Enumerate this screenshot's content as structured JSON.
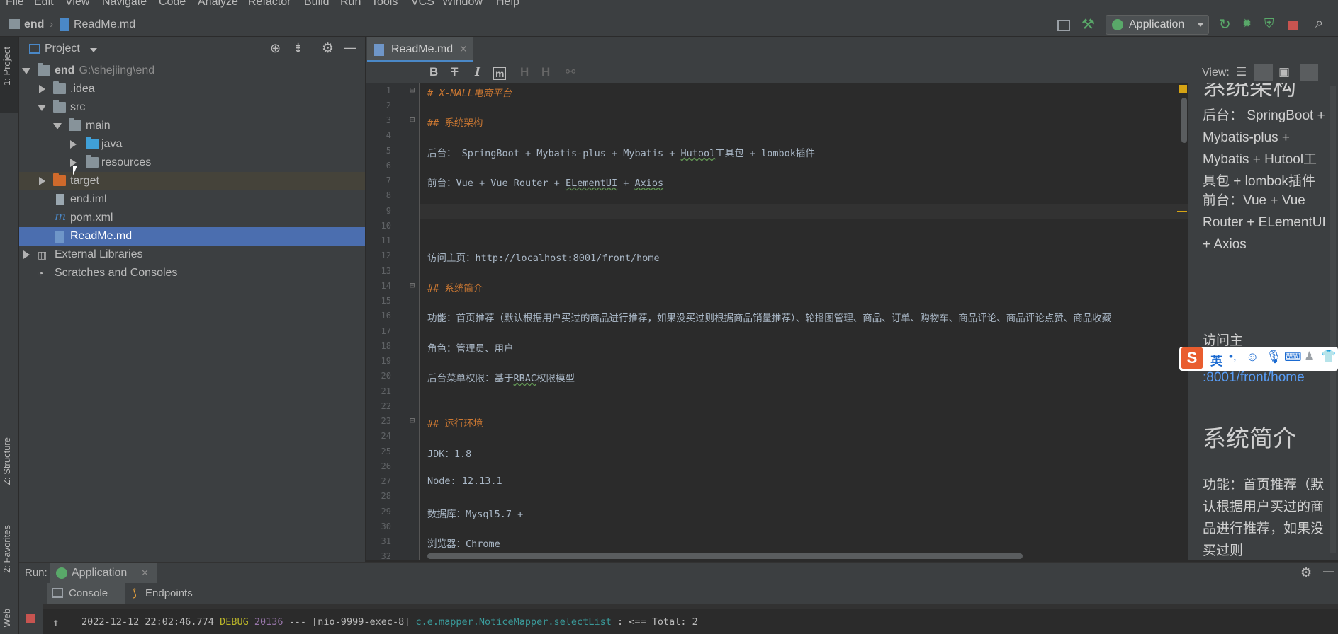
{
  "menu": [
    "File",
    "Edit",
    "View",
    "Navigate",
    "Code",
    "Analyze",
    "Refactor",
    "Build",
    "Run",
    "Tools",
    "VCS",
    "Window",
    "Help"
  ],
  "breadcrumb": {
    "project": "end",
    "file": "ReadMe.md"
  },
  "toolbar": {
    "run_config": "Application"
  },
  "left_tabs": {
    "project": "1: Project",
    "structure": "Z: Structure",
    "favorites": "2: Favorites",
    "web": "Web"
  },
  "project_panel": {
    "title": "Project",
    "tree": [
      {
        "label": "end",
        "path": "G:\\shejiing\\end"
      },
      {
        "label": ".idea"
      },
      {
        "label": "src"
      },
      {
        "label": "main"
      },
      {
        "label": "java"
      },
      {
        "label": "resources"
      },
      {
        "label": "target"
      },
      {
        "label": "end.iml"
      },
      {
        "label": "pom.xml"
      },
      {
        "label": "ReadMe.md"
      },
      {
        "label": "External Libraries"
      },
      {
        "label": "Scratches and Consoles"
      }
    ]
  },
  "editor": {
    "tab": "ReadMe.md",
    "line_numbers": [
      "1",
      "2",
      "3",
      "4",
      "5",
      "6",
      "7",
      "8",
      "9",
      "10",
      "11",
      "12",
      "13",
      "14",
      "15",
      "16",
      "17",
      "18",
      "19",
      "20",
      "21",
      "22",
      "23",
      "24",
      "25",
      "26",
      "27",
      "28",
      "29",
      "30",
      "31",
      "32"
    ],
    "lines": {
      "l1": "# X-MALL电商平台",
      "l3": "## 系统架构",
      "l5a": "后台： SpringBoot + Mybatis-plus + Mybatis + ",
      "l5b": "Hutool",
      "l5c": "工具包 + lombok插件",
      "l7a": "前台：Vue + Vue Router + ",
      "l7b": "ELementUI",
      "l7c": " + ",
      "l7d": "Axios",
      "l12": "访问主页：http://localhost:8001/front/home",
      "l14": "## 系统简介",
      "l16": "功能：首页推荐（默认根据用户买过的商品进行推荐，如果没买过则根据商品销量推荐）、轮播图管理、商品、订单、购物车、商品评论、商品评论点赞、商品收藏",
      "l18": "角色：管理员、用户",
      "l20a": "后台菜单权限：基于",
      "l20b": "RBAC",
      "l20c": "权限模型",
      "l23": "## 运行环境",
      "l25": "JDK：1.8",
      "l27": "Node:  12.13.1",
      "l29": "数据库：Mysql5.7 +",
      "l31": "浏览器：Chrome"
    }
  },
  "preview": {
    "view_label": "View:",
    "h_arch": "系统架构",
    "p_backend": "后台： SpringBoot + Mybatis-plus + Mybatis + Hutool工具包 + lombok插件",
    "p_frontend": "前台：Vue + Vue Router + ELementUI + Axios",
    "p_visit": "访问主",
    "p_link": ":8001/front/home",
    "h_intro": "系统简介",
    "p_func": "功能：首页推荐（默认根据用户买过的商品进行推荐，如果没买过则"
  },
  "ime": {
    "lang": "英"
  },
  "run": {
    "label": "Run:",
    "config": "Application",
    "tab_console": "Console",
    "tab_endpoints": "Endpoints",
    "log": {
      "ts": "2022-12-12 22:02:46.774",
      "level": "DEBUG",
      "pid": "20136",
      "sep": "---",
      "thread": "[nio-9999-exec-8]",
      "logger": "c.e.mapper.NoticeMapper.selectList",
      "msg": ": <==       Total: 2"
    }
  },
  "colors": {
    "accent": "#4b6eaf",
    "bg": "#2b2b2b",
    "panel": "#3c3f41",
    "heading": "#cc7832"
  }
}
